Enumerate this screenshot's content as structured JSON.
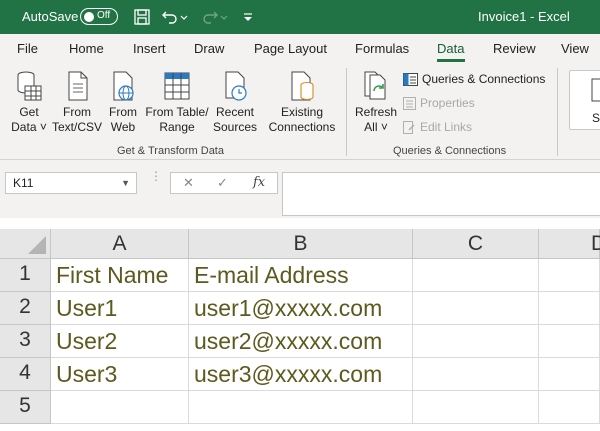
{
  "titlebar": {
    "autosave_label": "AutoSave",
    "autosave_state": "Off",
    "doc_title": "Invoice1  -  Excel",
    "icons": [
      "save-icon",
      "undo-icon",
      "redo-icon",
      "customize-qat-icon"
    ]
  },
  "tabs": [
    {
      "label": "File"
    },
    {
      "label": "Home"
    },
    {
      "label": "Insert"
    },
    {
      "label": "Draw"
    },
    {
      "label": "Page Layout"
    },
    {
      "label": "Formulas"
    },
    {
      "label": "Data",
      "active": true
    },
    {
      "label": "Review"
    },
    {
      "label": "View"
    }
  ],
  "ribbon": {
    "get_transform": {
      "group_label": "Get & Transform Data",
      "get_data": {
        "line1": "Get",
        "line2": "Data ˅"
      },
      "from_text_csv": {
        "line1": "From",
        "line2": "Text/CSV"
      },
      "from_web": {
        "line1": "From",
        "line2": "Web"
      },
      "from_table_range": {
        "line1": "From Table/",
        "line2": "Range"
      },
      "recent_sources": {
        "line1": "Recent",
        "line2": "Sources"
      },
      "existing_connections": {
        "line1": "Existing",
        "line2": "Connections"
      }
    },
    "queries_connections": {
      "group_label": "Queries & Connections",
      "refresh_all": {
        "line1": "Refresh",
        "line2": "All ˅"
      },
      "queries_connections_btn": "Queries & Connections",
      "properties_btn": "Properties",
      "edit_links_btn": "Edit Links"
    },
    "partial_button_label": "St"
  },
  "formula_bar": {
    "name_box": "K11",
    "cancel_glyph": "✕",
    "enter_glyph": "✓",
    "fx_glyph": "fx",
    "formula_value": ""
  },
  "sheet": {
    "columns": [
      "A",
      "B",
      "C",
      "D"
    ],
    "rows": [
      "1",
      "2",
      "3",
      "4",
      "5"
    ],
    "cells": [
      [
        "First Name",
        "E-mail Address",
        "",
        ""
      ],
      [
        "User1",
        "user1@xxxxx.com",
        "",
        ""
      ],
      [
        "User2",
        "user2@xxxxx.com",
        "",
        ""
      ],
      [
        "User3",
        "user3@xxxxx.com",
        "",
        ""
      ],
      [
        "",
        "",
        "",
        ""
      ]
    ]
  },
  "colors": {
    "excel_green": "#217346",
    "ribbon_bg": "#f3f2f1",
    "cell_text": "#5c5a1e"
  }
}
